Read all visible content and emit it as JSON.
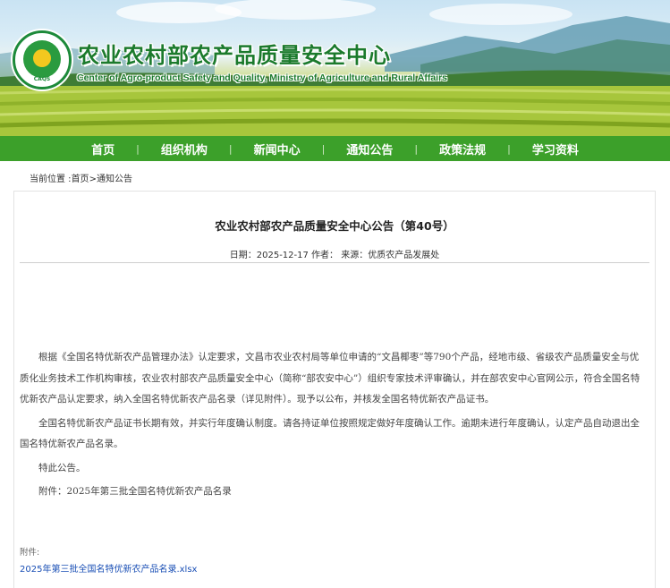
{
  "header": {
    "site_title": "农业农村部农产品质量安全中心",
    "site_subtitle": "Center of Agro-product Safety and Quality, Ministry of Agriculture and Rural Affairs",
    "logo_text": "CAQS"
  },
  "nav": {
    "items": [
      {
        "label": "首页"
      },
      {
        "label": "组织机构"
      },
      {
        "label": "新闻中心"
      },
      {
        "label": "通知公告"
      },
      {
        "label": "政策法规"
      },
      {
        "label": "学习资料"
      }
    ],
    "separator": "|"
  },
  "breadcrumb": {
    "prefix": "当前位置 :",
    "home": "首页",
    "sep": ">",
    "current": "通知公告"
  },
  "article": {
    "title": "农业农村部农产品质量安全中心公告（第40号）",
    "meta": "日期：2025-12-17 作者：  来源：优质农产品发展处",
    "paragraphs": [
      "根据《全国名特优新农产品管理办法》认定要求，文昌市农业农村局等单位申请的“文昌椰枣”等790个产品，经地市级、省级农产品质量安全与优质化业务技术工作机构审核，农业农村部农产品质量安全中心（简称“部农安中心”）组织专家技术评审确认，并在部农安中心官网公示，符合全国名特优新农产品认定要求，纳入全国名特优新农产品名录（详见附件）。现予以公布，并核发全国名特优新农产品证书。",
      "全国名特优新农产品证书长期有效，并实行年度确认制度。请各持证单位按照规定做好年度确认工作。逾期未进行年度确认，认定产品自动退出全国名特优新农产品名录。",
      "特此公告。",
      "附件：2025年第三批全国名特优新农产品名录"
    ],
    "attachment_label": "附件:",
    "attachment_link": "2025年第三批全国名特优新农产品名录.xlsx"
  },
  "colors": {
    "nav_bg": "#3ca02a",
    "title_green": "#1b7a2c",
    "link_blue": "#1a4fb5"
  }
}
